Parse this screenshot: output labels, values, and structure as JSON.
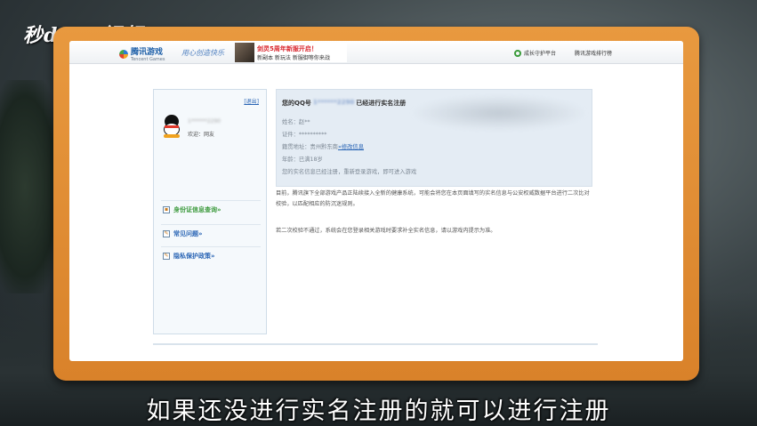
{
  "overlay": {
    "logo_text": "秒dong视频",
    "subtitle": "如果还没进行实名注册的就可以进行注册"
  },
  "site": {
    "brand": "腾讯游戏",
    "brand_sub": "Tencent Games",
    "slogan": "用心创造快乐",
    "banner_title": "剑灵5周年新服开启！",
    "banner_sub": "新副本 新玩法 新服御等你来战",
    "guard_label": "成长守护平台",
    "rank_label": "腾讯游戏排行榜"
  },
  "sidebar": {
    "logout": "[退出]",
    "qq_number": "1******2290",
    "welcome": "欢迎：网友",
    "links": [
      {
        "label": "身份证信息查询»"
      },
      {
        "label": "常见问题»"
      },
      {
        "label": "隐私保护政策»"
      }
    ]
  },
  "info": {
    "title_prefix": "您的QQ号",
    "title_hidden": "1******2290",
    "title_suffix": "已经进行实名注册",
    "name": "姓名：赵**",
    "id": "证件：**********",
    "address_prefix": "籍贯地址：贵州黔东南",
    "address_link": "»修改信息",
    "age": "年龄：已满18岁",
    "note": "您的实名信息已经注册，重新登录游戏，即可进入游戏"
  },
  "paragraphs": {
    "p1": "目前，腾讯旗下全部游戏产品正陆续接入全新的健康系统，可能会将您在本页面填写的实名信息与公安权威数据平台进行二次比对校验，以匹配相应的防沉迷规则。",
    "p2": "若二次校验不通过，系统会在您登录相关游戏时要求补全实名信息，请以游戏内提示为准。"
  },
  "colors": {
    "frame": "#e0892f",
    "accent_blue": "#2a65b5",
    "accent_green": "#3c9a3c"
  }
}
